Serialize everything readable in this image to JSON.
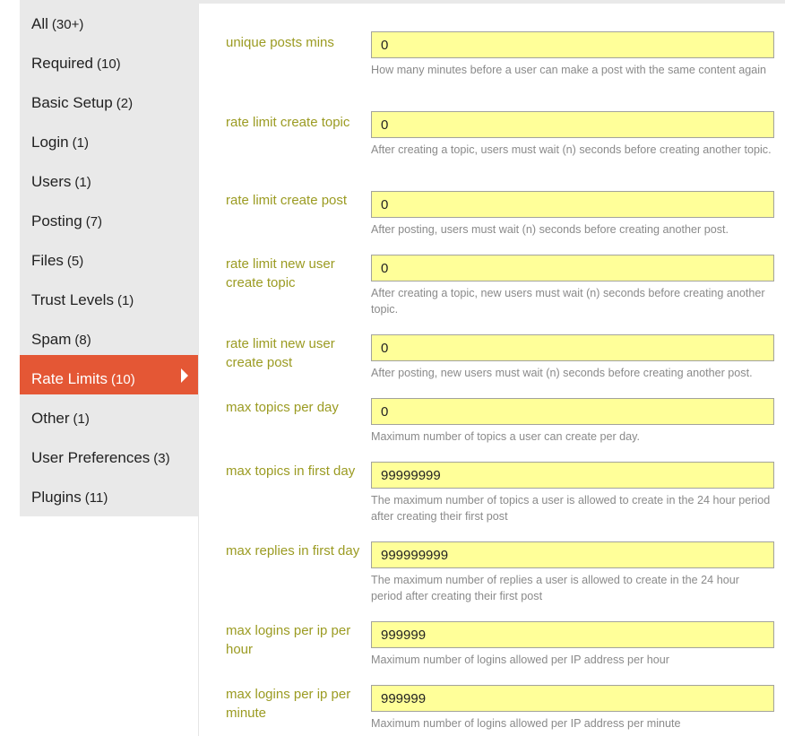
{
  "nav": {
    "items": [
      {
        "label": "All",
        "count": "(30+)"
      },
      {
        "label": "Required",
        "count": "(10)"
      },
      {
        "label": "Basic Setup",
        "count": "(2)"
      },
      {
        "label": "Login",
        "count": "(1)"
      },
      {
        "label": "Users",
        "count": "(1)"
      },
      {
        "label": "Posting",
        "count": "(7)"
      },
      {
        "label": "Files",
        "count": "(5)"
      },
      {
        "label": "Trust Levels",
        "count": "(1)"
      },
      {
        "label": "Spam",
        "count": "(8)"
      },
      {
        "label": "Rate Limits",
        "count": "(10)"
      },
      {
        "label": "Other",
        "count": "(1)"
      },
      {
        "label": "User Preferences",
        "count": "(3)"
      },
      {
        "label": "Plugins",
        "count": "(11)"
      }
    ],
    "active_index": 9
  },
  "settings": [
    {
      "label": "unique posts mins",
      "value": "0",
      "description": "How many minutes before a user can make a post with the same content again"
    },
    {
      "label": "rate limit create topic",
      "value": "0",
      "description": "After creating a topic, users must wait (n) seconds before creating another topic."
    },
    {
      "label": "rate limit create post",
      "value": "0",
      "description": "After posting, users must wait (n) seconds before creating another post."
    },
    {
      "label": "rate limit new user create topic",
      "value": "0",
      "description": "After creating a topic, new users must wait (n) seconds before creating another topic."
    },
    {
      "label": "rate limit new user create post",
      "value": "0",
      "description": "After posting, new users must wait (n) seconds before creating another post."
    },
    {
      "label": "max topics per day",
      "value": "0",
      "description": "Maximum number of topics a user can create per day."
    },
    {
      "label": "max topics in first day",
      "value": "99999999",
      "description": "The maximum number of topics a user is allowed to create in the 24 hour period after creating their first post"
    },
    {
      "label": "max replies in first day",
      "value": "999999999",
      "description": "The maximum number of replies a user is allowed to create in the 24 hour period after creating their first post"
    },
    {
      "label": "max logins per ip per hour",
      "value": "999999",
      "description": "Maximum number of logins allowed per IP address per hour"
    },
    {
      "label": "max logins per ip per minute",
      "value": "999999",
      "description": "Maximum number of logins allowed per IP address per minute"
    }
  ],
  "colors": {
    "active_bg": "#e45735",
    "sidebar_bg": "#e9e9e9",
    "label_color": "#9b9b22",
    "input_bg": "#ffff99"
  }
}
